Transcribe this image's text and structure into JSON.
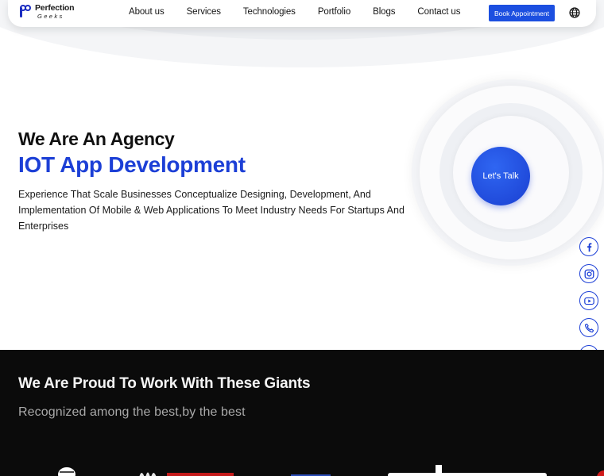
{
  "header": {
    "logo": {
      "name": "Perfection",
      "sub": "Geeks"
    },
    "nav": [
      "About us",
      "Services",
      "Technologies",
      "Portfolio",
      "Blogs",
      "Contact us"
    ],
    "book_button": "Book Appointment",
    "globe_icon": "globe-icon"
  },
  "hero": {
    "subtitle": "We Are An Agency",
    "title": "IOT App Development",
    "description": "Experience That Scale Businesses Conceptualize Designing, Development, And Implementation Of Mobile & Web Applications To Meet Industry Needs For Startups And Enterprises",
    "talk_button": "Let's Talk"
  },
  "social": [
    "facebook-icon",
    "instagram-icon",
    "youtube-icon",
    "phone-icon",
    "whatsapp-icon"
  ],
  "giants": {
    "title": "We Are Proud To Work With These Giants",
    "subtitle": "Recognized among the best,by the best"
  },
  "colors": {
    "accent": "#1c3fd6",
    "button": "#1c4fe0",
    "dark_bg": "#0b0b0b"
  }
}
